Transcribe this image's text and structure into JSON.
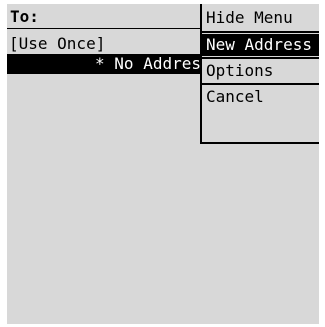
{
  "compose": {
    "to_label": "To:",
    "recipients": [
      "[Use Once]",
      "* No Addres"
    ]
  },
  "menu": {
    "items": [
      "Hide Menu",
      "New Address",
      "Options",
      "Cancel"
    ],
    "selected": "New Address"
  }
}
